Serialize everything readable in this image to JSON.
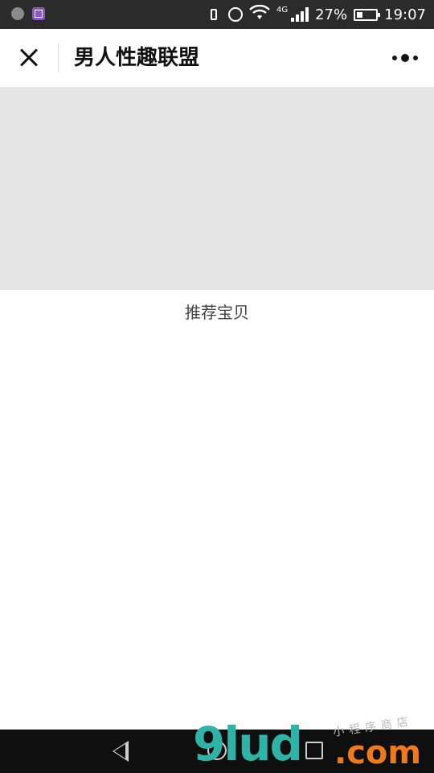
{
  "status_bar": {
    "network_type": "4G",
    "battery_percent": "27%",
    "time": "19:07"
  },
  "header": {
    "title": "男人性趣联盟"
  },
  "content": {
    "recommend_label": "推荐宝贝"
  },
  "watermark": {
    "main": "9lud",
    "suffix": ".com",
    "small": "小程序商店"
  }
}
